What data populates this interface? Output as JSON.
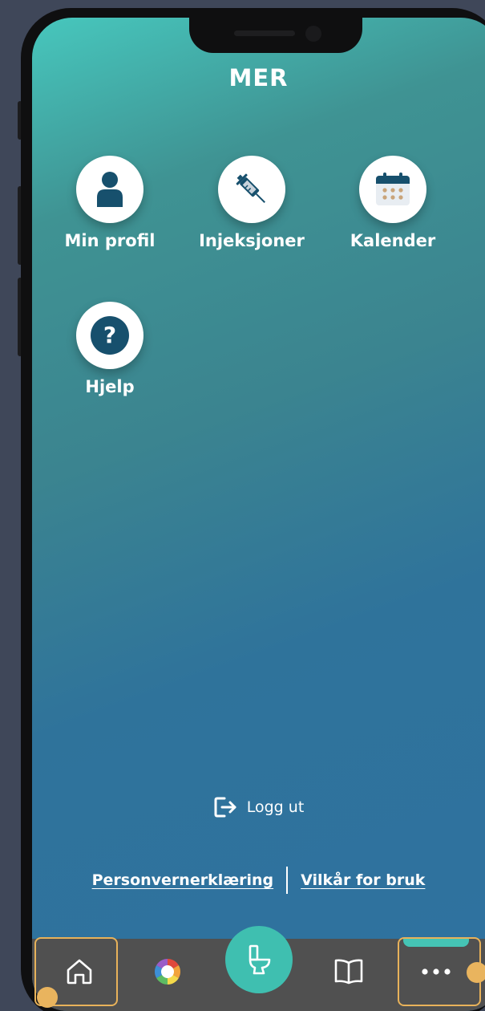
{
  "header": {
    "title": "MER"
  },
  "menu": {
    "items": [
      {
        "label": "Min profil",
        "icon": "person-icon"
      },
      {
        "label": "Injeksjoner",
        "icon": "syringe-icon"
      },
      {
        "label": "Kalender",
        "icon": "calendar-icon"
      },
      {
        "label": "Hjelp",
        "icon": "help-icon"
      }
    ]
  },
  "logout": {
    "label": "Logg ut",
    "icon": "logout-icon"
  },
  "footer_links": {
    "privacy": "Personvernerklæring",
    "terms": "Vilkår for bruk"
  },
  "bottom_nav": {
    "items": [
      {
        "icon": "home-icon"
      },
      {
        "icon": "color-wheel-icon"
      },
      {
        "icon": "toilet-icon"
      },
      {
        "icon": "book-icon"
      },
      {
        "icon": "more-icon",
        "active": true
      }
    ]
  },
  "colors": {
    "teal_accent": "#3fbfb0",
    "navy_icon": "#17506d",
    "highlight": "#e8b25a",
    "nav_background": "#505050"
  }
}
